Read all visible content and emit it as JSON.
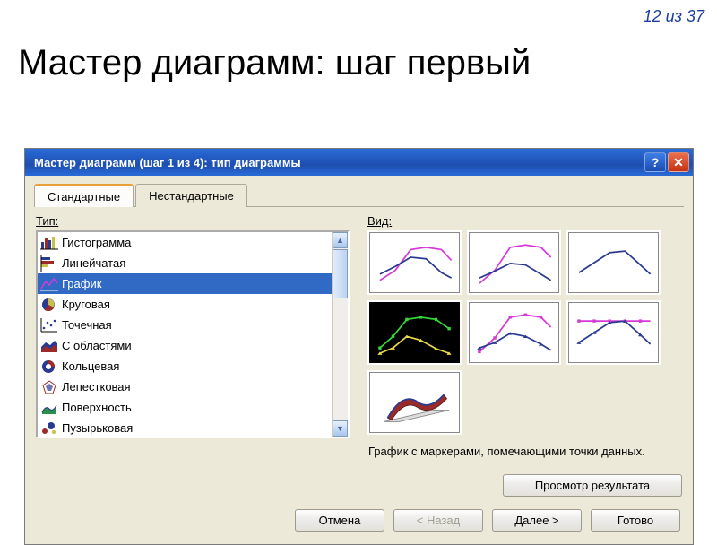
{
  "page_counter": "12 из 37",
  "slide_title": "Мастер диаграмм: шаг первый",
  "dialog": {
    "title": "Мастер диаграмм (шаг 1 из 4): тип диаграммы",
    "tabs": {
      "standard": "Стандартные",
      "custom": "Нестандартные"
    },
    "type_label": "Тип:",
    "view_label": "Вид:",
    "types": [
      "Гистограмма",
      "Линейчатая",
      "График",
      "Круговая",
      "Точечная",
      "С областями",
      "Кольцевая",
      "Лепестковая",
      "Поверхность",
      "Пузырьковая"
    ],
    "selected_type_index": 2,
    "selected_subtype_index": 3,
    "description": "График с маркерами, помечающими точки данных.",
    "preview_button": "Просмотр результата",
    "buttons": {
      "cancel": "Отмена",
      "back": "< Назад",
      "next": "Далее >",
      "finish": "Готово"
    }
  }
}
